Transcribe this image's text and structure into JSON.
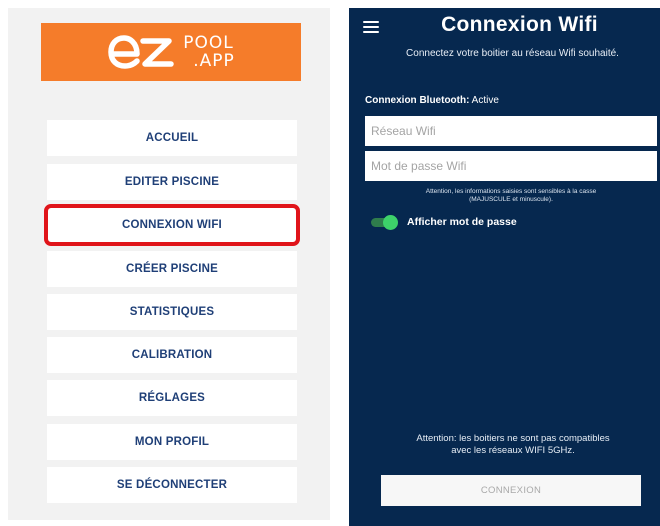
{
  "menu": {
    "logo": {
      "letters": "ez",
      "line1": "POOL",
      "line2": ".APP",
      "color": "#f57c2a"
    },
    "items": [
      {
        "label": "ACCUEIL",
        "selected": false
      },
      {
        "label": "EDITER PISCINE",
        "selected": false
      },
      {
        "label": "CONNEXION WIFI",
        "selected": true
      },
      {
        "label": "CRÉER PISCINE",
        "selected": false
      },
      {
        "label": "STATISTIQUES",
        "selected": false
      },
      {
        "label": "CALIBRATION",
        "selected": false
      },
      {
        "label": "RÉGLAGES",
        "selected": false
      },
      {
        "label": "MON PROFIL",
        "selected": false
      },
      {
        "label": "SE DÉCONNECTER",
        "selected": false
      }
    ],
    "highlight_color": "#e0141a",
    "item_text_color": "#1f3f77"
  },
  "wifi_screen": {
    "menu_icon": "hamburger-menu-icon",
    "title": "Connexion Wifi",
    "subtitle": "Connectez votre boitier au réseau Wifi souhaité.",
    "bluetooth": {
      "label": "Connexion Bluetooth:",
      "value": "Active"
    },
    "ssid_placeholder": "Réseau Wifi",
    "password_placeholder": "Mot de passe Wifi",
    "case_warning_line1": "Attention, les informations saisies sont sensibles à la casse",
    "case_warning_line2": "(MAJUSCULE et minuscule).",
    "show_password": {
      "label": "Afficher mot de passe",
      "on": true
    },
    "compat_warning_line1": "Attention: les boitiers ne sont pas compatibles",
    "compat_warning_line2": "avec les réseaux WIFI 5GHz.",
    "connect_label": "CONNEXION",
    "background_color": "#06284f",
    "toggle_color": "#3dd26a"
  }
}
